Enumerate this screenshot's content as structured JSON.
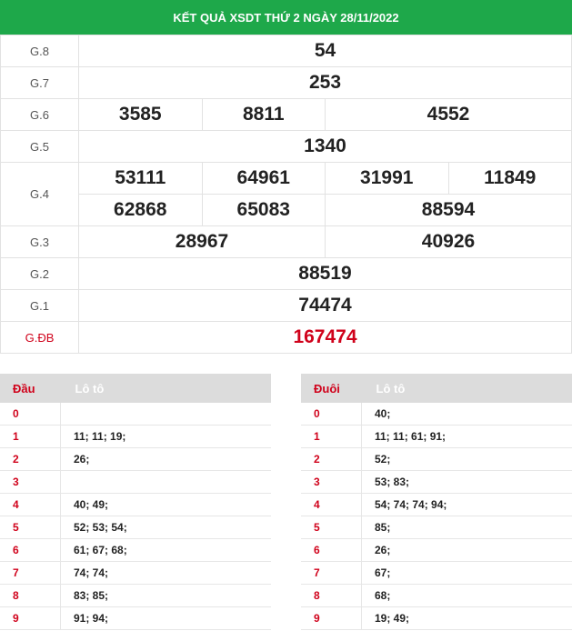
{
  "header": {
    "title": "KẾT QUẢ XSDT THỨ 2 NGÀY 28/11/2022"
  },
  "prizes": {
    "g8": {
      "label": "G.8",
      "values": [
        "54"
      ]
    },
    "g7": {
      "label": "G.7",
      "values": [
        "253"
      ]
    },
    "g6": {
      "label": "G.6",
      "values": [
        "3585",
        "8811",
        "4552"
      ]
    },
    "g5": {
      "label": "G.5",
      "values": [
        "1340"
      ]
    },
    "g4": {
      "label": "G.4",
      "values": [
        "53111",
        "64961",
        "31991",
        "11849",
        "62868",
        "65083",
        "88594"
      ]
    },
    "g3": {
      "label": "G.3",
      "values": [
        "28967",
        "40926"
      ]
    },
    "g2": {
      "label": "G.2",
      "values": [
        "88519"
      ]
    },
    "g1": {
      "label": "G.1",
      "values": [
        "74474"
      ]
    },
    "gdb": {
      "label": "G.ĐB",
      "values": [
        "167474"
      ]
    }
  },
  "loto_head": {
    "col1": "Đầu",
    "col2": "Lô tô",
    "rows": [
      {
        "k": "0",
        "v": ""
      },
      {
        "k": "1",
        "v": "11; 11; 19;"
      },
      {
        "k": "2",
        "v": "26;"
      },
      {
        "k": "3",
        "v": ""
      },
      {
        "k": "4",
        "v": "40; 49;"
      },
      {
        "k": "5",
        "v": "52; 53; 54;"
      },
      {
        "k": "6",
        "v": "61; 67; 68;"
      },
      {
        "k": "7",
        "v": "74; 74;"
      },
      {
        "k": "8",
        "v": "83; 85;"
      },
      {
        "k": "9",
        "v": "91; 94;"
      }
    ]
  },
  "loto_tail": {
    "col1": "Đuôi",
    "col2": "Lô tô",
    "rows": [
      {
        "k": "0",
        "v": "40;"
      },
      {
        "k": "1",
        "v": "11; 11; 61; 91;"
      },
      {
        "k": "2",
        "v": "52;"
      },
      {
        "k": "3",
        "v": "53; 83;"
      },
      {
        "k": "4",
        "v": "54; 74; 74; 94;"
      },
      {
        "k": "5",
        "v": "85;"
      },
      {
        "k": "6",
        "v": "26;"
      },
      {
        "k": "7",
        "v": "67;"
      },
      {
        "k": "8",
        "v": "68;"
      },
      {
        "k": "9",
        "v": "19; 49;"
      }
    ]
  }
}
